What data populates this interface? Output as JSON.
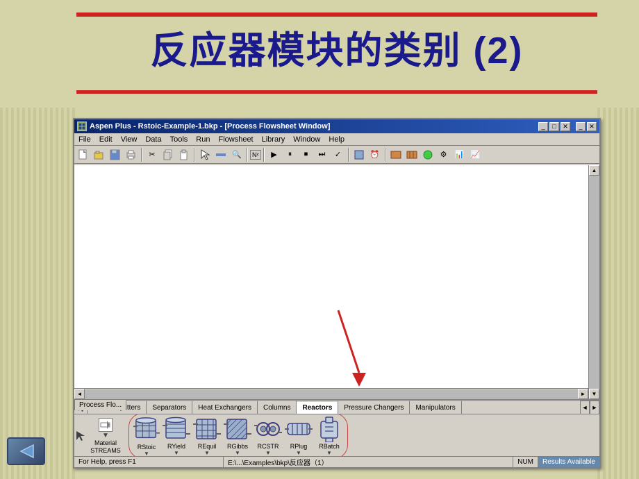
{
  "slide": {
    "title": "反应器模块的类别 (2)",
    "title_number": "(2)"
  },
  "app": {
    "title": "Aspen Plus - Rstoic-Example-1.bkp - [Process Flowsheet Window]",
    "menu_items": [
      "File",
      "Edit",
      "View",
      "Data",
      "Tools",
      "Run",
      "Flowsheet",
      "Library",
      "Window",
      "Help"
    ],
    "titlebar_buttons": [
      "_",
      "□",
      "✕"
    ],
    "process_tab_label": "Process Flo...",
    "status_bar": {
      "help_text": "For Help, press F1",
      "path_text": "E:\\...\\Examples\\bkp\\反应器（1）",
      "num_text": "NUM",
      "results_text": "Results Available"
    }
  },
  "bottom_panel": {
    "categories": [
      {
        "label": "Mixers/Splitters",
        "active": false
      },
      {
        "label": "Separators",
        "active": false
      },
      {
        "label": "Heat Exchangers",
        "active": false
      },
      {
        "label": "Columns",
        "active": false
      },
      {
        "label": "Reactors",
        "active": true
      },
      {
        "label": "Pressure Changers",
        "active": false
      },
      {
        "label": "Manipulators",
        "active": false
      }
    ],
    "stream_label": "Material\nSTREAMS",
    "reactors": [
      {
        "id": "rstoic",
        "label": "RStoic"
      },
      {
        "id": "ryield",
        "label": "RYield"
      },
      {
        "id": "requi",
        "label": "REquil"
      },
      {
        "id": "rgibbs",
        "label": "RGibbs"
      },
      {
        "id": "rcstr",
        "label": "RCSTR"
      },
      {
        "id": "rplug",
        "label": "RPlug"
      },
      {
        "id": "rbatch",
        "label": "RBatch"
      }
    ]
  }
}
